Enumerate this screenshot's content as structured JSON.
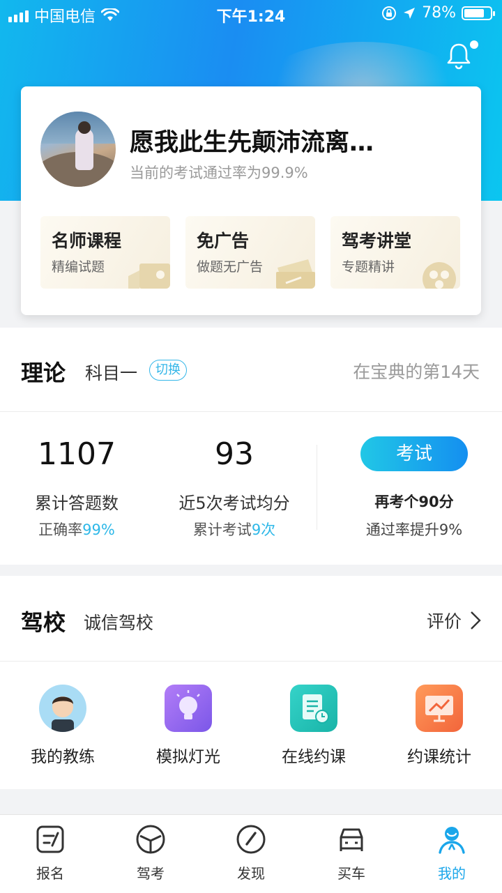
{
  "status_bar": {
    "carrier": "中国电信",
    "time": "下午1:24",
    "battery": "78%",
    "battery_level": 0.78
  },
  "profile": {
    "username": "愿我此生先颠沛流离…",
    "pass_rate_text": "当前的考试通过率为99.9%"
  },
  "features": [
    {
      "title": "名师课程",
      "subtitle": "精编试题",
      "icon": "video-camera-icon"
    },
    {
      "title": "免广告",
      "subtitle": "做题无广告",
      "icon": "ticket-icon"
    },
    {
      "title": "驾考讲堂",
      "subtitle": "专题精讲",
      "icon": "film-reel-icon"
    }
  ],
  "theory": {
    "title": "理论",
    "subject": "科目一",
    "switch_label": "切换",
    "days_text": "在宝典的第14天",
    "stats": {
      "answered_count": "1107",
      "answered_label": "累计答题数",
      "accuracy_prefix": "正确率",
      "accuracy_value": "99%",
      "avg_score": "93",
      "avg_label": "近5次考试均分",
      "exam_count_prefix": "累计考试",
      "exam_count_value": "9次"
    },
    "exam_button": "考试",
    "exam_note_1": "再考个90分",
    "exam_note_2": "通过率提升9%"
  },
  "school": {
    "title": "驾校",
    "name": "诚信驾校",
    "review_label": "评价",
    "tools": [
      {
        "label": "我的教练",
        "icon": "coach-avatar-icon"
      },
      {
        "label": "模拟灯光",
        "icon": "light-bulb-icon"
      },
      {
        "label": "在线约课",
        "icon": "schedule-document-icon"
      },
      {
        "label": "约课统计",
        "icon": "statistics-chart-icon"
      }
    ]
  },
  "tabs": [
    {
      "label": "报名",
      "icon": "signup-icon"
    },
    {
      "label": "驾考",
      "icon": "steering-wheel-icon"
    },
    {
      "label": "发现",
      "icon": "compass-icon"
    },
    {
      "label": "买车",
      "icon": "car-icon"
    },
    {
      "label": "我的",
      "icon": "profile-icon",
      "active": true
    }
  ],
  "colors": {
    "accent": "#1aa6ea",
    "highlight": "#2eb8e8",
    "hero_start": "#12b8ee",
    "hero_end": "#1a8df2"
  }
}
